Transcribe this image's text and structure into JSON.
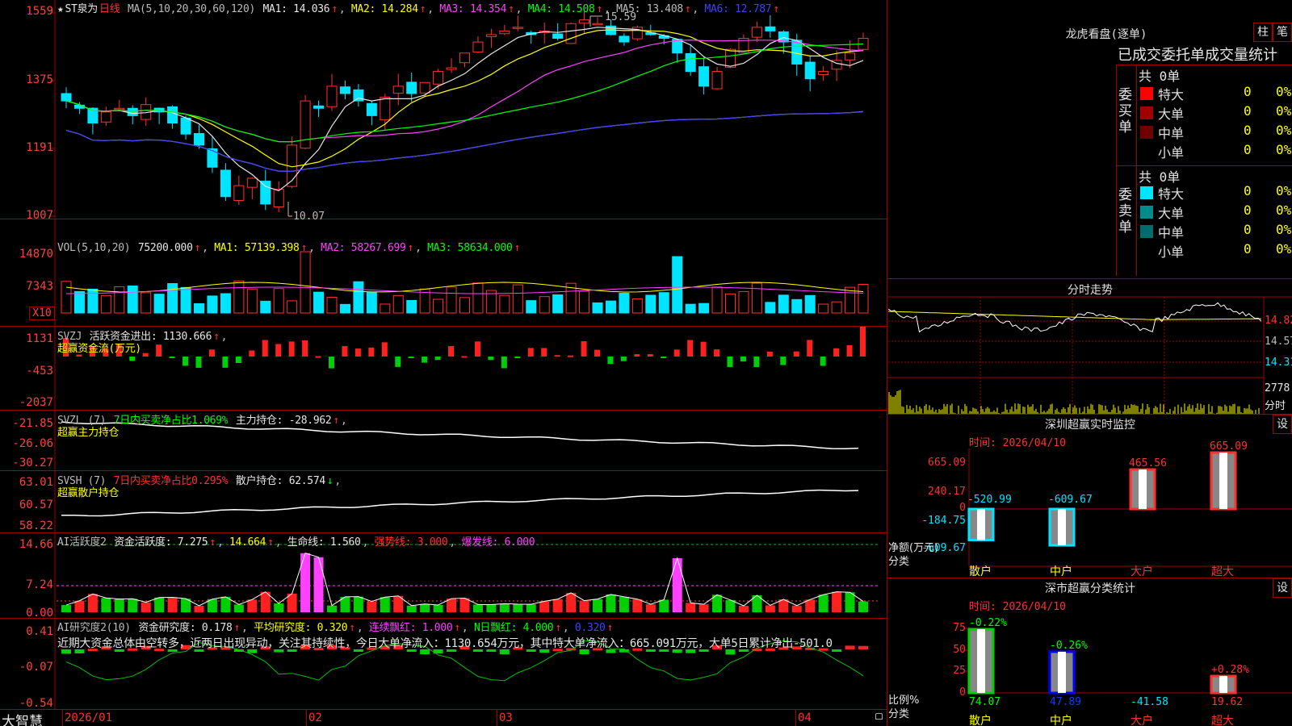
{
  "kline": {
    "y_ticks": [
      "1559",
      "1375",
      "1191",
      "1007"
    ],
    "legend": {
      "star": "★",
      "name": "ST泉为",
      "period": "日线",
      "ma_label": "MA(5,10,20,30,60,120)",
      "ma1": "MA1: 14.036",
      "ma2": "MA2: 14.284",
      "ma3": "MA3: 14.354",
      "ma4": "MA4: 14.508",
      "ma5": "MA5: 13.408",
      "ma6": "MA6: 12.787"
    },
    "high_label": "15.59",
    "low_label": "10.07"
  },
  "vol": {
    "y_ticks": [
      "14870",
      "7343",
      "X10"
    ],
    "legend": {
      "name": "VOL(5,10,20)",
      "v": "75200.000",
      "ma1": "MA1: 57139.398",
      "ma2": "MA2: 58267.699",
      "ma3": "MA3: 58634.000"
    }
  },
  "svzj": {
    "y_ticks": [
      "1131",
      "-453",
      "-2037"
    ],
    "legend": {
      "name": "SVZJ",
      "a": "活跃资金进出: 1130.666",
      "b": "超赢资金流(万元)"
    }
  },
  "svzl": {
    "y_ticks": [
      "-21.85",
      "-26.06",
      "-30.27"
    ],
    "legend": {
      "name": "SVZL (7)",
      "a": "7日内买卖净占比1.069%",
      "b": "主力持仓: -28.962",
      "c": "超赢主力持仓"
    }
  },
  "svsh": {
    "y_ticks": [
      "63.01",
      "60.57",
      "58.22"
    ],
    "legend": {
      "name": "SVSH (7)",
      "a": "7日内买卖净占比0.295%",
      "b": "散户持仓: 62.574",
      "c": "超赢散户持仓"
    }
  },
  "ai_act": {
    "y_ticks": [
      "14.66",
      "7.24",
      "0.00"
    ],
    "legend": {
      "name": "AI活跃度2",
      "a": "资金活跃度: 7.275",
      "b": "14.664",
      "c": "生命线: 1.560",
      "d": "强势线: 3.000",
      "e": "爆发线: 6.000"
    }
  },
  "ai_res": {
    "y_ticks": [
      "0.41",
      "-0.07",
      "-0.54"
    ],
    "legend": {
      "name": "AI研究度2(10)",
      "a": "资金研究度: 0.178",
      "b": "平均研究度: 0.320",
      "c": "连续飘红: 1.000",
      "d": "N日飘红: 4.000",
      "e": "0.320"
    },
    "comment": "近期大资金总体由空转多，近两日出现异动，关注其持续性，今日大单净流入：1130.654万元，其中特大单净流入：665.091万元，大单5日累计净出-501.0"
  },
  "bottom": {
    "brand": "大智慧",
    "dates": [
      "2026/01",
      "02",
      "03",
      "04"
    ]
  },
  "dragon": {
    "title": "龙虎看盘(逐单)",
    "btn_bar": "柱",
    "btn_pen": "笔",
    "header": "已成交委托单成交量统计",
    "buy_side": "委买单",
    "sell_side": "委卖单",
    "buy_total": "共 0单",
    "sell_total": "共 0单",
    "buy_rows": [
      {
        "name": "特大",
        "n": "0",
        "p": "0%",
        "color": "#ff0000"
      },
      {
        "name": "大单",
        "n": "0",
        "p": "0%",
        "color": "#a00000"
      },
      {
        "name": "中单",
        "n": "0",
        "p": "0%",
        "color": "#700000"
      },
      {
        "name": "小单",
        "n": "0",
        "p": "0%",
        "color": "#000000"
      }
    ],
    "sell_rows": [
      {
        "name": "特大",
        "n": "0",
        "p": "0%",
        "color": "#00e5ff"
      },
      {
        "name": "大单",
        "n": "0",
        "p": "0%",
        "color": "#008c8c"
      },
      {
        "name": "中单",
        "n": "0",
        "p": "0%",
        "color": "#006c6c"
      },
      {
        "name": "小单",
        "n": "0",
        "p": "0%",
        "color": "#000000"
      }
    ]
  },
  "intraday": {
    "title": "分时走势",
    "y_ticks": [
      "14.82",
      "14.57",
      "14.31"
    ],
    "vol_label": "2778",
    "vol_unit": "分时"
  },
  "monitor": {
    "title": "深圳超赢实时监控",
    "btn": "设",
    "date": "时间: 2026/04/10",
    "axis_label_a": "净额(万元)",
    "axis_label_b": "分类",
    "y_ticks": [
      "665.09",
      "240.17",
      "0",
      "-184.75",
      "-609.67"
    ],
    "categories": [
      "散户",
      "中户",
      "大户",
      "超大"
    ]
  },
  "classify": {
    "title": "深市超赢分类统计",
    "btn": "设",
    "date": "时间: 2026/04/10",
    "axis_label_a": "比例%",
    "axis_label_b": "分类",
    "y_ticks": [
      "75",
      "50",
      "25",
      "0"
    ],
    "categories": [
      "散户",
      "中户",
      "大户",
      "超大"
    ]
  },
  "chart_data": [
    {
      "type": "bar",
      "title": "深圳超赢实时监控",
      "categories": [
        "散户",
        "中户",
        "大户",
        "超大"
      ],
      "values": [
        -520.99,
        -609.67,
        465.56,
        665.09
      ],
      "ylabel": "净额(万元)",
      "ylim": [
        -609.67,
        665.09
      ]
    },
    {
      "type": "bar",
      "title": "深市超赢分类统计",
      "categories": [
        "散户",
        "中户",
        "大户",
        "超大"
      ],
      "values": [
        74.07,
        47.89,
        -41.58,
        19.62
      ],
      "changes": [
        "-0.22%",
        "-0.26%",
        "",
        "+0.28%"
      ],
      "ylabel": "比例%",
      "ylim": [
        0,
        75
      ]
    }
  ]
}
